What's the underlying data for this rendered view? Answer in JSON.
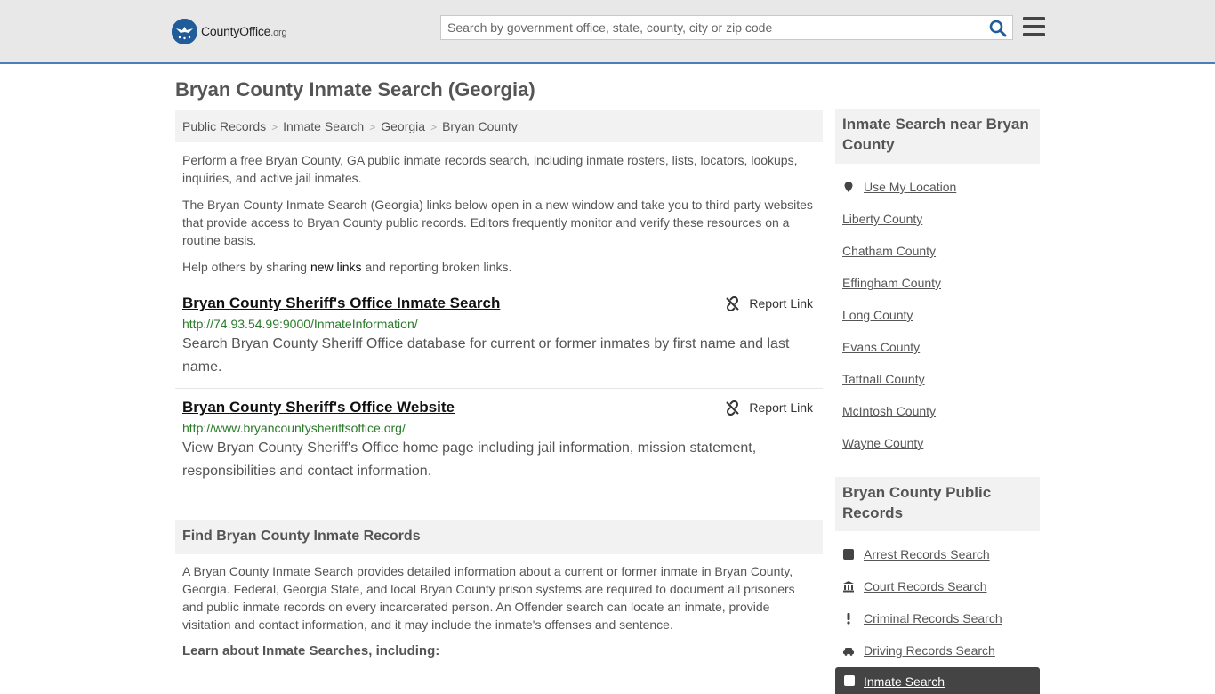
{
  "header": {
    "logo_name": "CountyOffice",
    "logo_tld": ".org",
    "search_placeholder": "Search by government office, state, county, city or zip code"
  },
  "page_title": "Bryan County Inmate Search (Georgia)",
  "breadcrumb": [
    "Public Records",
    "Inmate Search",
    "Georgia",
    "Bryan County"
  ],
  "intro": {
    "p1": "Perform a free Bryan County, GA public inmate records search, including inmate rosters, lists, locators, lookups, inquiries, and active jail inmates.",
    "p2": "The Bryan County Inmate Search (Georgia) links below open in a new window and take you to third party websites that provide access to Bryan County public records. Editors frequently monitor and verify these resources on a routine basis.",
    "p3_before": "Help others by sharing ",
    "p3_link": "new links",
    "p3_after": " and reporting broken links."
  },
  "results": [
    {
      "title": "Bryan County Sheriff's Office Inmate Search",
      "url": "http://74.93.54.99:9000/InmateInformation/",
      "description": "Search Bryan County Sheriff Office database for current or former inmates by first name and last name.",
      "report_label": "Report Link"
    },
    {
      "title": "Bryan County Sheriff's Office Website",
      "url": "http://www.bryancountysheriffsoffice.org/",
      "description": "View Bryan County Sheriff's Office home page including jail information, mission statement, responsibilities and contact information.",
      "report_label": "Report Link"
    }
  ],
  "find_section": {
    "heading": "Find Bryan County Inmate Records",
    "body": "A Bryan County Inmate Search provides detailed information about a current or former inmate in Bryan County, Georgia. Federal, Georgia State, and local Bryan County prison systems are required to document all prisoners and public inmate records on every incarcerated person. An Offender search can locate an inmate, provide visitation and contact information, and it may include the inmate's offenses and sentence.",
    "learn_heading": "Learn about Inmate Searches, including:"
  },
  "sidebar": {
    "nearby_heading": "Inmate Search near Bryan County",
    "use_location": "Use My Location",
    "nearby": [
      "Liberty County",
      "Chatham County",
      "Effingham County",
      "Long County",
      "Evans County",
      "Tattnall County",
      "McIntosh County",
      "Wayne County"
    ],
    "records_heading": "Bryan County Public Records",
    "records": [
      {
        "label": "Arrest Records Search",
        "icon": "square-icon"
      },
      {
        "label": "Court Records Search",
        "icon": "courthouse-icon"
      },
      {
        "label": "Criminal Records Search",
        "icon": "exclamation-icon"
      },
      {
        "label": "Driving Records Search",
        "icon": "car-icon"
      }
    ],
    "active_item": "Inmate Search"
  }
}
